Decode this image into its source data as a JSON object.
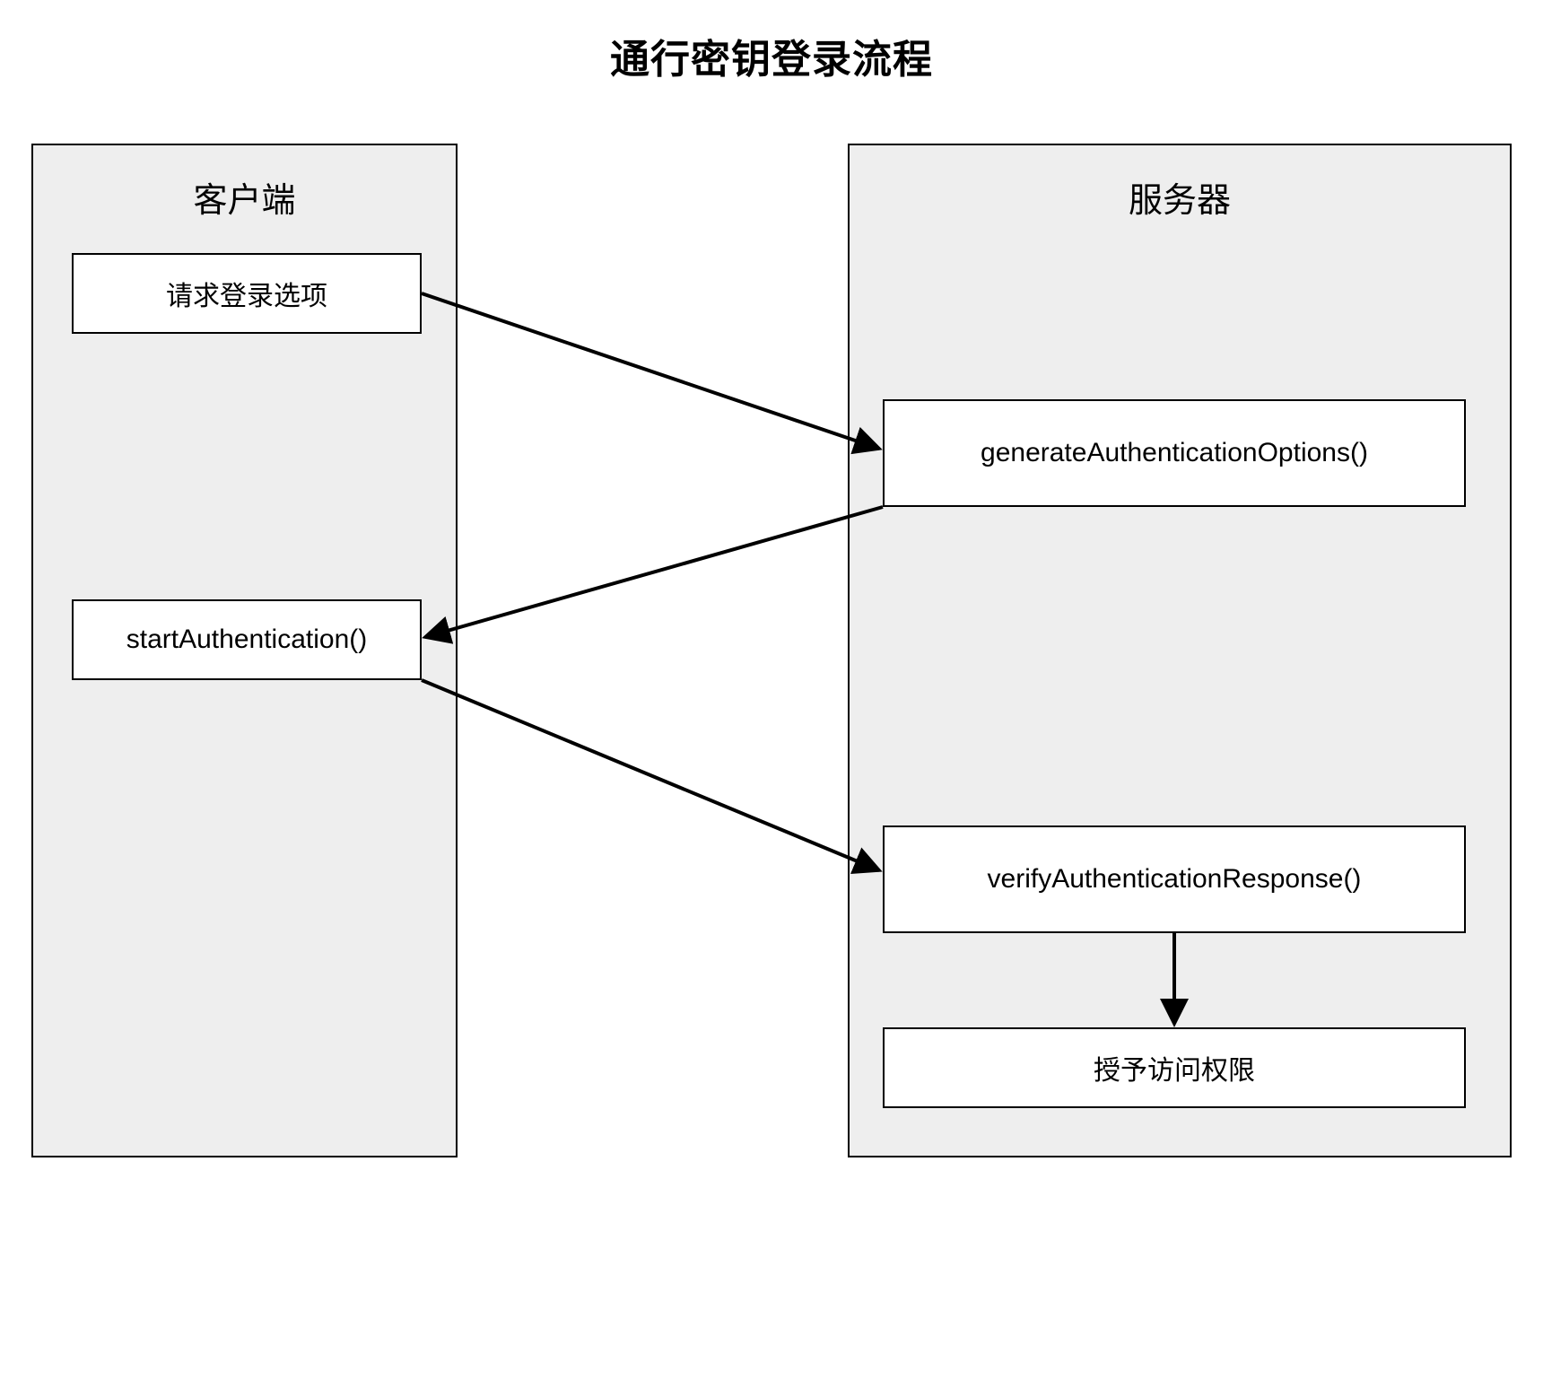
{
  "title": "通行密钥登录流程",
  "lanes": {
    "client": {
      "header": "客户端"
    },
    "server": {
      "header": "服务器"
    }
  },
  "nodes": {
    "request_login_options": "请求登录选项",
    "generate_auth_options": "generateAuthenticationOptions()",
    "start_authentication": "startAuthentication()",
    "verify_auth_response": "verifyAuthenticationResponse()",
    "grant_access": "授予访问权限"
  }
}
